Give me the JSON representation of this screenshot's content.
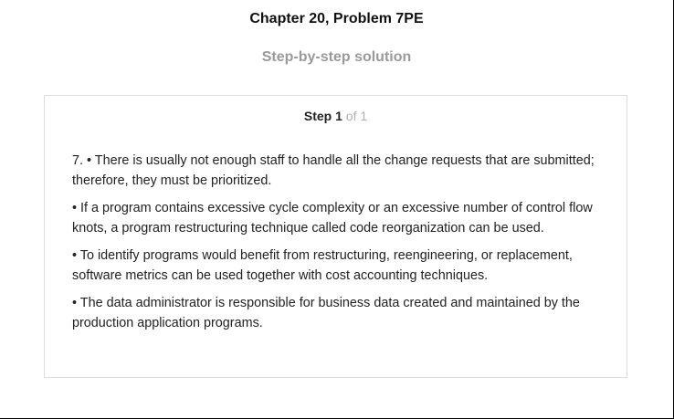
{
  "header": {
    "chapter_title": "Chapter 20, Problem 7PE",
    "subtitle": "Step-by-step solution"
  },
  "step": {
    "label": "Step",
    "number": "1",
    "of_text": "of 1"
  },
  "paragraphs": [
    "7. • There is usually not enough staff to handle all the change requests that are submitted; therefore, they must be prioritized.",
    "• If a program contains excessive cycle complexity or an excessive number of control flow knots, a program restructuring technique called code reorganization can be used.",
    "• To identify programs would benefit from restructuring, reengineering, or replacement, software metrics can be used together with cost accounting techniques.",
    "• The data administrator is responsible for business data created and maintained by the production application programs."
  ],
  "colors": {
    "title": "#111111",
    "subtitle": "#9a9a9a",
    "card_border": "#dcdcdc",
    "step_of": "#b0b0b0"
  }
}
